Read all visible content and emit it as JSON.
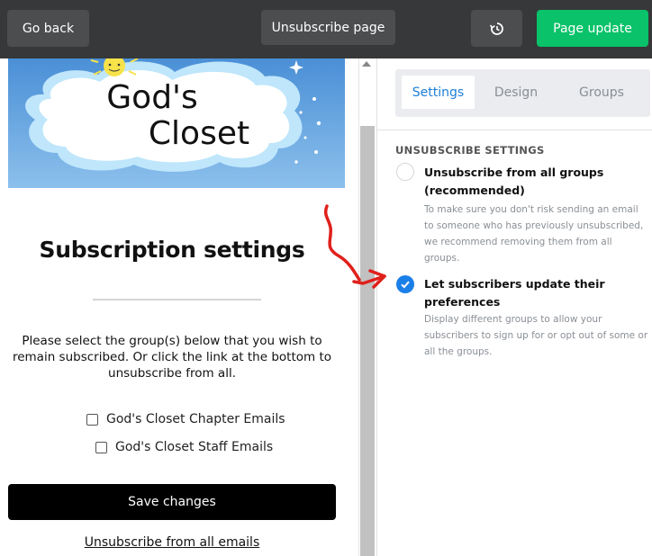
{
  "toolbar": {
    "back_label": "Go back",
    "page_label": "Unsubscribe page",
    "history_icon": "history-icon",
    "update_label": "Page update"
  },
  "preview": {
    "logo_text_line1": "God's",
    "logo_text_line2": "Closet",
    "title": "Subscription settings",
    "intro": "Please select the group(s) below that you wish to remain subscribed. Or click the link at the bottom to unsubscribe from all.",
    "groups": [
      {
        "label": "God's Closet Chapter Emails",
        "checked": false
      },
      {
        "label": "God's Closet Staff Emails",
        "checked": false
      }
    ],
    "save_label": "Save changes",
    "unsubscribe_link": "Unsubscribe from all emails"
  },
  "panel": {
    "tabs": [
      {
        "label": "Settings",
        "active": true
      },
      {
        "label": "Design",
        "active": false
      },
      {
        "label": "Groups",
        "active": false
      }
    ],
    "section_heading": "UNSUBSCRIBE SETTINGS",
    "options": [
      {
        "title": "Unsubscribe from all groups (recommended)",
        "description": "To make sure you don't risk sending an email to someone who has previously unsubscribed, we recommend removing them from all groups.",
        "selected": false
      },
      {
        "title": "Let subscribers update their preferences",
        "description": "Display different groups to allow your subscribers to sign up for or opt out of some or all the groups.",
        "selected": true
      }
    ]
  },
  "colors": {
    "toolbar_bg": "#363839",
    "primary_green": "#09c269",
    "accent_blue": "#1b7fd8",
    "annotation_red": "#e0201b"
  }
}
